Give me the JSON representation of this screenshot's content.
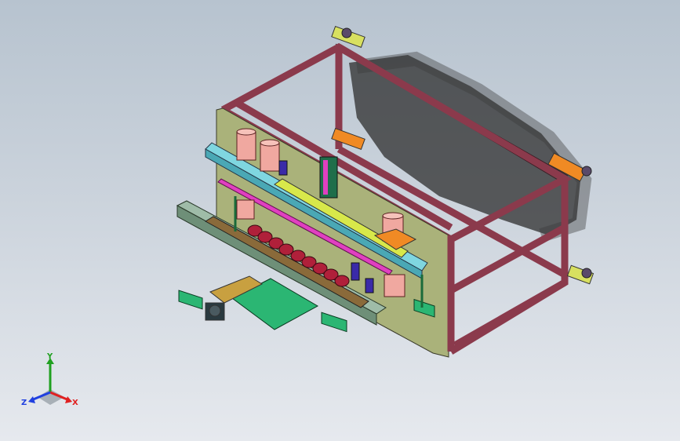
{
  "viewport": {
    "background_top": "#b7c3cf",
    "background_bottom": "#e6e9ee",
    "frame_color": "#8b3a4c",
    "plate_color": "#aab27a",
    "rail_color": "#7ea38a",
    "accent_colors": {
      "cylinder": "#f0a8a0",
      "magenta_rail": "#e040c0",
      "yellow_rail": "#d8e84a",
      "cyan_rail": "#7fd6e0",
      "green_base": "#2bb673",
      "orange_block": "#f08a24",
      "roller": "#b0203a"
    }
  },
  "triad": {
    "x_label": "X",
    "y_label": "Y",
    "z_label": "Z",
    "x_color": "#e02020",
    "y_color": "#20a020",
    "z_color": "#2040e0"
  }
}
